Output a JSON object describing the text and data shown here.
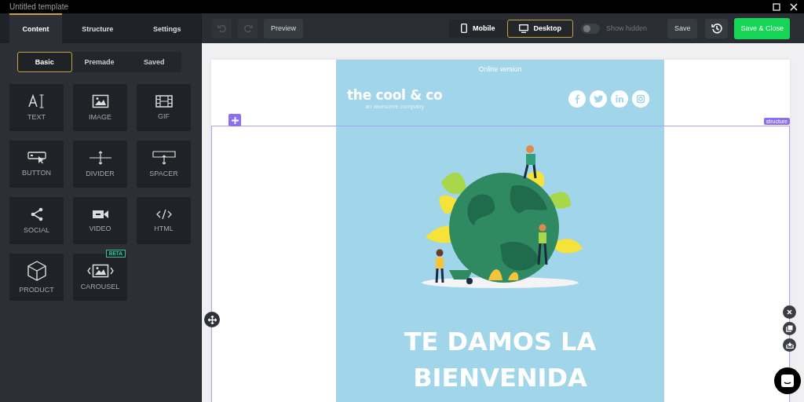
{
  "window": {
    "title": "Untitled template"
  },
  "sidebar": {
    "tabs": [
      {
        "label": "Content",
        "selected": true
      },
      {
        "label": "Structure",
        "selected": false
      },
      {
        "label": "Settings",
        "selected": false
      }
    ],
    "subtabs": [
      {
        "label": "Basic",
        "selected": true
      },
      {
        "label": "Premade",
        "selected": false
      },
      {
        "label": "Saved",
        "selected": false
      }
    ],
    "blocks": [
      {
        "kind": "text",
        "label": "TEXT"
      },
      {
        "kind": "image",
        "label": "IMAGE"
      },
      {
        "kind": "gif",
        "label": "GIF"
      },
      {
        "kind": "button",
        "label": "BUTTON"
      },
      {
        "kind": "divider",
        "label": "DIVIDER"
      },
      {
        "kind": "spacer",
        "label": "SPACER"
      },
      {
        "kind": "social",
        "label": "SOCIAL"
      },
      {
        "kind": "video",
        "label": "VIDEO"
      },
      {
        "kind": "html",
        "label": "HTML"
      },
      {
        "kind": "product",
        "label": "PRODUCT"
      },
      {
        "kind": "carousel",
        "label": "CAROUSEL",
        "badge": "BETA"
      }
    ]
  },
  "toolbar": {
    "undo_disabled": true,
    "redo_disabled": true,
    "preview": "Preview",
    "views": [
      {
        "kind": "mobile",
        "label": "Mobile",
        "selected": false
      },
      {
        "kind": "desktop",
        "label": "Desktop",
        "selected": true
      }
    ],
    "show_hidden": {
      "label": "Show hidden",
      "on": false
    },
    "save": "Save",
    "save_close": "Save & Close"
  },
  "email": {
    "online_version": "Online version",
    "brand": "the cool & co",
    "tagline": "an awesome company",
    "socials": [
      {
        "kind": "facebook"
      },
      {
        "kind": "twitter"
      },
      {
        "kind": "linkedin"
      },
      {
        "kind": "instagram"
      }
    ],
    "structure_tag": "structure",
    "heading": "TE DAMOS LA BIENVENIDA"
  }
}
